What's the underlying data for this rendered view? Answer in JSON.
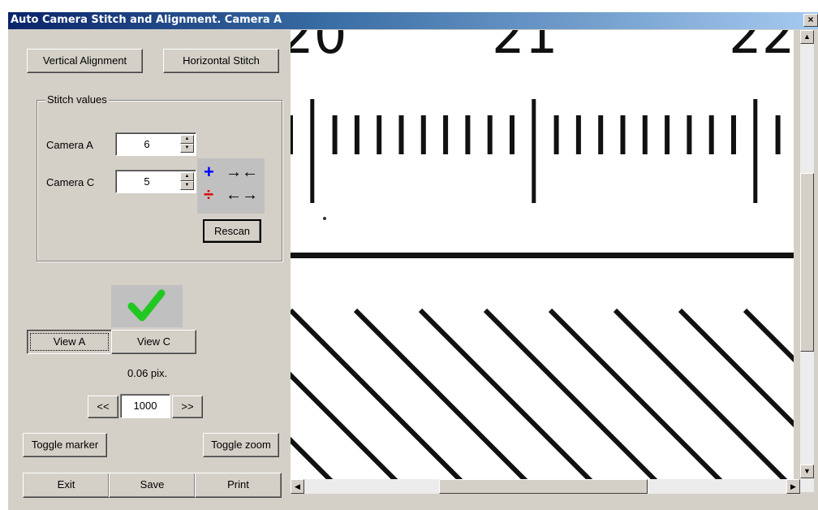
{
  "window": {
    "title": "Auto Camera Stitch and Alignment.  Camera A",
    "close_label": "×"
  },
  "top_buttons": {
    "vertical": "Vertical Alignment",
    "horizontal": "Horizontal Stitch"
  },
  "stitch": {
    "group_label": "Stitch values",
    "camera_a_label": "Camera A",
    "camera_a_value": "6",
    "camera_c_label": "Camera C",
    "camera_c_value": "5",
    "indicators": {
      "plus": "+",
      "converge": "→←",
      "divide": "÷",
      "diverge": "←→"
    },
    "rescan": "Rescan"
  },
  "status": {
    "icon": "checkmark-icon",
    "color": "#22c822"
  },
  "view_buttons": {
    "view_a": "View A",
    "view_c": "View C"
  },
  "offset_readout": "0.06 pix.",
  "frame_nav": {
    "prev": "<<",
    "value": "1000",
    "next": ">>"
  },
  "toggles": {
    "marker": "Toggle marker",
    "zoom": "Toggle zoom"
  },
  "bottom_buttons": {
    "exit": "Exit",
    "save": "Save",
    "print": "Print"
  },
  "image_view": {
    "visible_scale_numbers": [
      "20",
      "21",
      "22"
    ]
  }
}
